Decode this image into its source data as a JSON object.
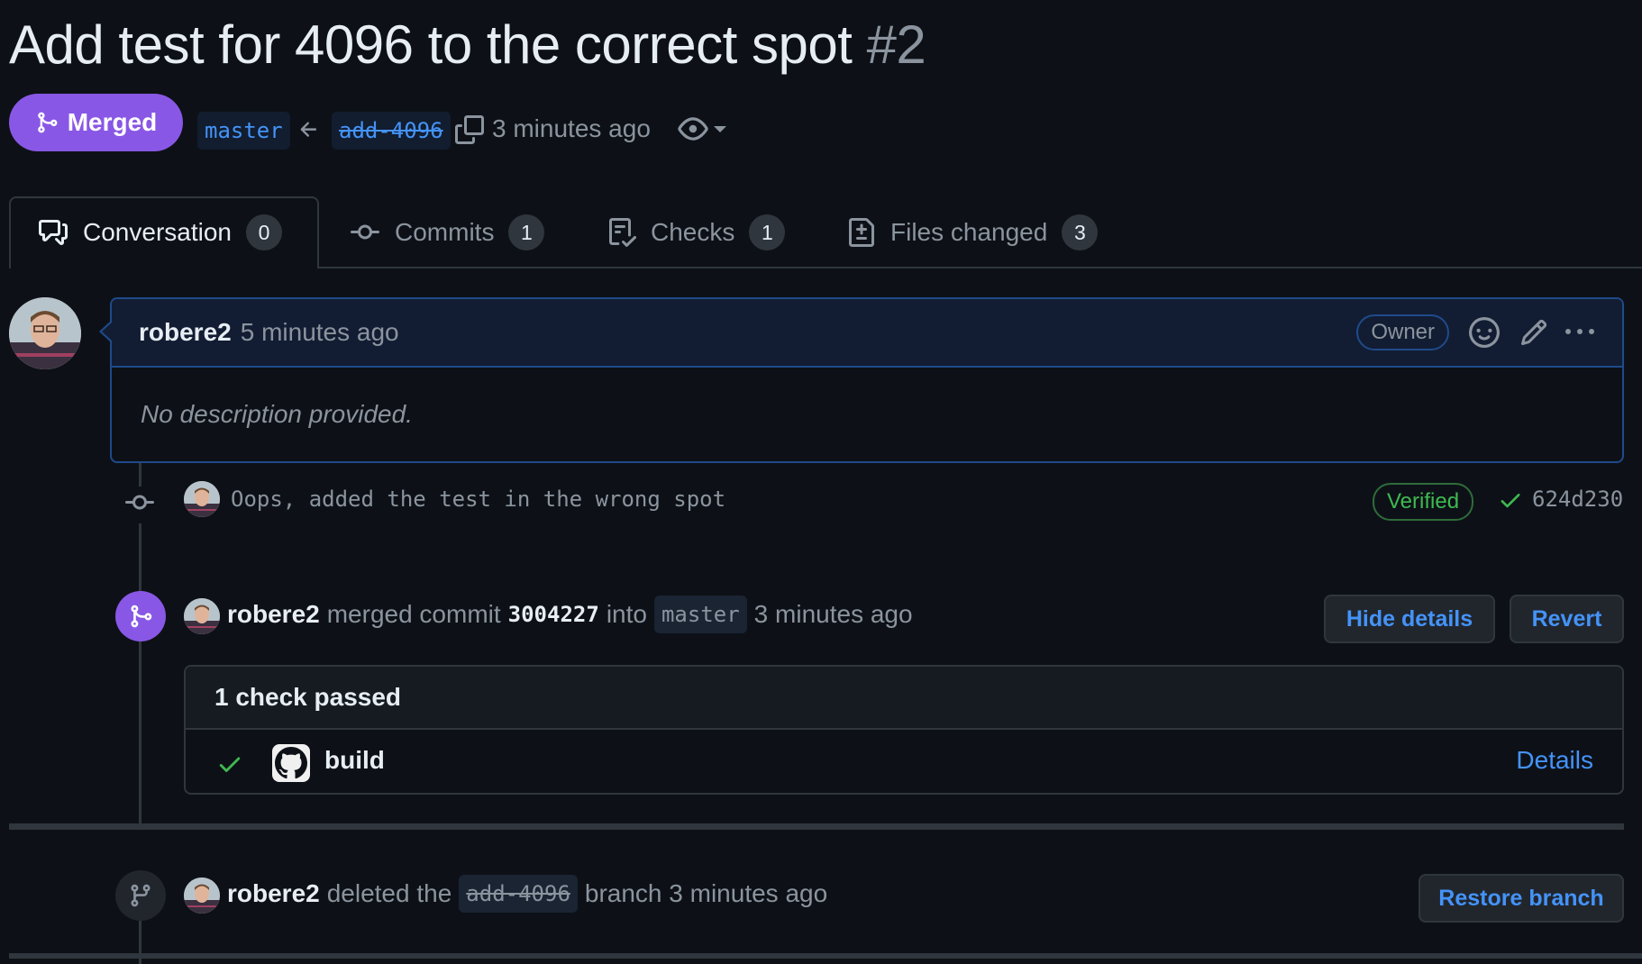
{
  "pr": {
    "title": "Add test for 4096 to the correct spot",
    "number": "#2",
    "state_label": "Merged",
    "base_branch": "master",
    "head_branch": "add-4096",
    "time": "3 minutes ago"
  },
  "tabs": [
    {
      "label": "Conversation",
      "count": "0"
    },
    {
      "label": "Commits",
      "count": "1"
    },
    {
      "label": "Checks",
      "count": "1"
    },
    {
      "label": "Files changed",
      "count": "3"
    }
  ],
  "comment": {
    "author": "robere2",
    "time": "5 minutes ago",
    "role_badge": "Owner",
    "body": "No description provided."
  },
  "commit": {
    "message": "Oops, added the test in the wrong spot",
    "verified": "Verified",
    "sha": "624d230"
  },
  "merge_event": {
    "user": "robere2",
    "action": "merged commit",
    "sha": "3004227",
    "into": "into",
    "branch": "master",
    "time": "3 minutes ago",
    "hide_details": "Hide details",
    "revert": "Revert"
  },
  "checks": {
    "header": "1 check passed",
    "name": "build",
    "details": "Details"
  },
  "delete_event": {
    "user": "robere2",
    "action": "deleted the",
    "branch": "add-4096",
    "suffix": "branch 3 minutes ago",
    "restore": "Restore branch"
  },
  "colors": {
    "merged": "#8957e5",
    "link": "#4493f8",
    "success": "#3fb950",
    "background": "#0d1117"
  }
}
